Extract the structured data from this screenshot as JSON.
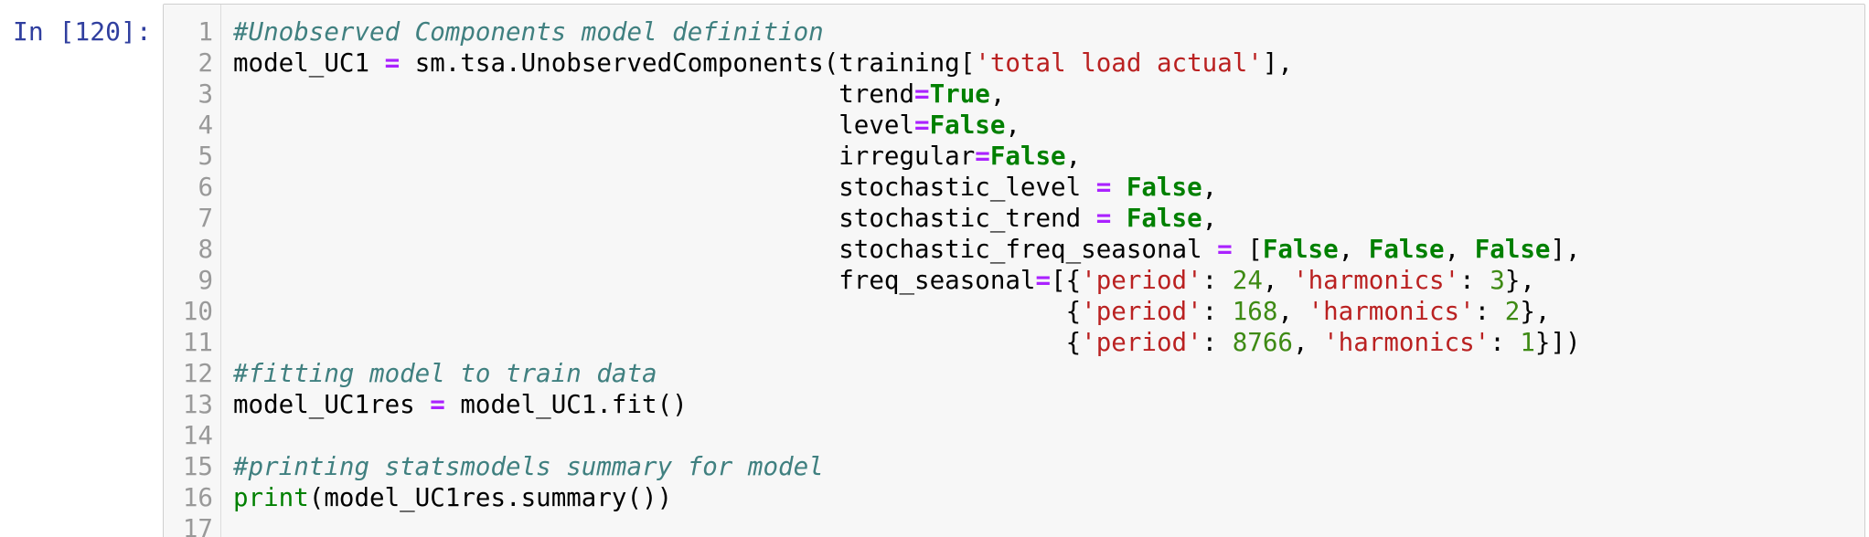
{
  "prompt": "In [120]:",
  "lines": [
    {
      "n": "1",
      "parts": [
        {
          "t": "#Unobserved Components model definition",
          "k": "comment"
        }
      ]
    },
    {
      "n": "2",
      "parts": [
        {
          "t": "model_UC1 ",
          "k": "plain"
        },
        {
          "t": "=",
          "k": "op"
        },
        {
          "t": " sm.tsa.UnobservedComponents(training[",
          "k": "plain"
        },
        {
          "t": "'total load actual'",
          "k": "str"
        },
        {
          "t": "],",
          "k": "plain"
        }
      ]
    },
    {
      "n": "3",
      "parts": [
        {
          "t": "                                        trend",
          "k": "plain"
        },
        {
          "t": "=",
          "k": "op"
        },
        {
          "t": "True",
          "k": "kw"
        },
        {
          "t": ",",
          "k": "plain"
        }
      ]
    },
    {
      "n": "4",
      "parts": [
        {
          "t": "                                        level",
          "k": "plain"
        },
        {
          "t": "=",
          "k": "op"
        },
        {
          "t": "False",
          "k": "kw"
        },
        {
          "t": ",",
          "k": "plain"
        }
      ]
    },
    {
      "n": "5",
      "parts": [
        {
          "t": "                                        irregular",
          "k": "plain"
        },
        {
          "t": "=",
          "k": "op"
        },
        {
          "t": "False",
          "k": "kw"
        },
        {
          "t": ",",
          "k": "plain"
        }
      ]
    },
    {
      "n": "6",
      "parts": [
        {
          "t": "                                        stochastic_level ",
          "k": "plain"
        },
        {
          "t": "=",
          "k": "op"
        },
        {
          "t": " ",
          "k": "plain"
        },
        {
          "t": "False",
          "k": "kw"
        },
        {
          "t": ",",
          "k": "plain"
        }
      ]
    },
    {
      "n": "7",
      "parts": [
        {
          "t": "                                        stochastic_trend ",
          "k": "plain"
        },
        {
          "t": "=",
          "k": "op"
        },
        {
          "t": " ",
          "k": "plain"
        },
        {
          "t": "False",
          "k": "kw"
        },
        {
          "t": ",",
          "k": "plain"
        }
      ]
    },
    {
      "n": "8",
      "parts": [
        {
          "t": "                                        stochastic_freq_seasonal ",
          "k": "plain"
        },
        {
          "t": "=",
          "k": "op"
        },
        {
          "t": " [",
          "k": "plain"
        },
        {
          "t": "False",
          "k": "kw"
        },
        {
          "t": ", ",
          "k": "plain"
        },
        {
          "t": "False",
          "k": "kw"
        },
        {
          "t": ", ",
          "k": "plain"
        },
        {
          "t": "False",
          "k": "kw"
        },
        {
          "t": "],",
          "k": "plain"
        }
      ]
    },
    {
      "n": "9",
      "parts": [
        {
          "t": "                                        freq_seasonal",
          "k": "plain"
        },
        {
          "t": "=",
          "k": "op"
        },
        {
          "t": "[{",
          "k": "plain"
        },
        {
          "t": "'period'",
          "k": "str"
        },
        {
          "t": ": ",
          "k": "plain"
        },
        {
          "t": "24",
          "k": "num"
        },
        {
          "t": ", ",
          "k": "plain"
        },
        {
          "t": "'harmonics'",
          "k": "str"
        },
        {
          "t": ": ",
          "k": "plain"
        },
        {
          "t": "3",
          "k": "num"
        },
        {
          "t": "},",
          "k": "plain"
        }
      ]
    },
    {
      "n": "10",
      "parts": [
        {
          "t": "                                                       {",
          "k": "plain"
        },
        {
          "t": "'period'",
          "k": "str"
        },
        {
          "t": ": ",
          "k": "plain"
        },
        {
          "t": "168",
          "k": "num"
        },
        {
          "t": ", ",
          "k": "plain"
        },
        {
          "t": "'harmonics'",
          "k": "str"
        },
        {
          "t": ": ",
          "k": "plain"
        },
        {
          "t": "2",
          "k": "num"
        },
        {
          "t": "},",
          "k": "plain"
        }
      ]
    },
    {
      "n": "11",
      "parts": [
        {
          "t": "                                                       {",
          "k": "plain"
        },
        {
          "t": "'period'",
          "k": "str"
        },
        {
          "t": ": ",
          "k": "plain"
        },
        {
          "t": "8766",
          "k": "num"
        },
        {
          "t": ", ",
          "k": "plain"
        },
        {
          "t": "'harmonics'",
          "k": "str"
        },
        {
          "t": ": ",
          "k": "plain"
        },
        {
          "t": "1",
          "k": "num"
        },
        {
          "t": "}])",
          "k": "plain"
        }
      ]
    },
    {
      "n": "12",
      "parts": [
        {
          "t": "#fitting model to train data",
          "k": "comment"
        }
      ]
    },
    {
      "n": "13",
      "parts": [
        {
          "t": "model_UC1res ",
          "k": "plain"
        },
        {
          "t": "=",
          "k": "op"
        },
        {
          "t": " model_UC1.fit()",
          "k": "plain"
        }
      ]
    },
    {
      "n": "14",
      "parts": []
    },
    {
      "n": "15",
      "parts": [
        {
          "t": "#printing statsmodels summary for model",
          "k": "comment"
        }
      ]
    },
    {
      "n": "16",
      "parts": [
        {
          "t": "print",
          "k": "builtin"
        },
        {
          "t": "(model_UC1res.summary())",
          "k": "plain"
        }
      ]
    },
    {
      "n": "17",
      "parts": []
    }
  ]
}
